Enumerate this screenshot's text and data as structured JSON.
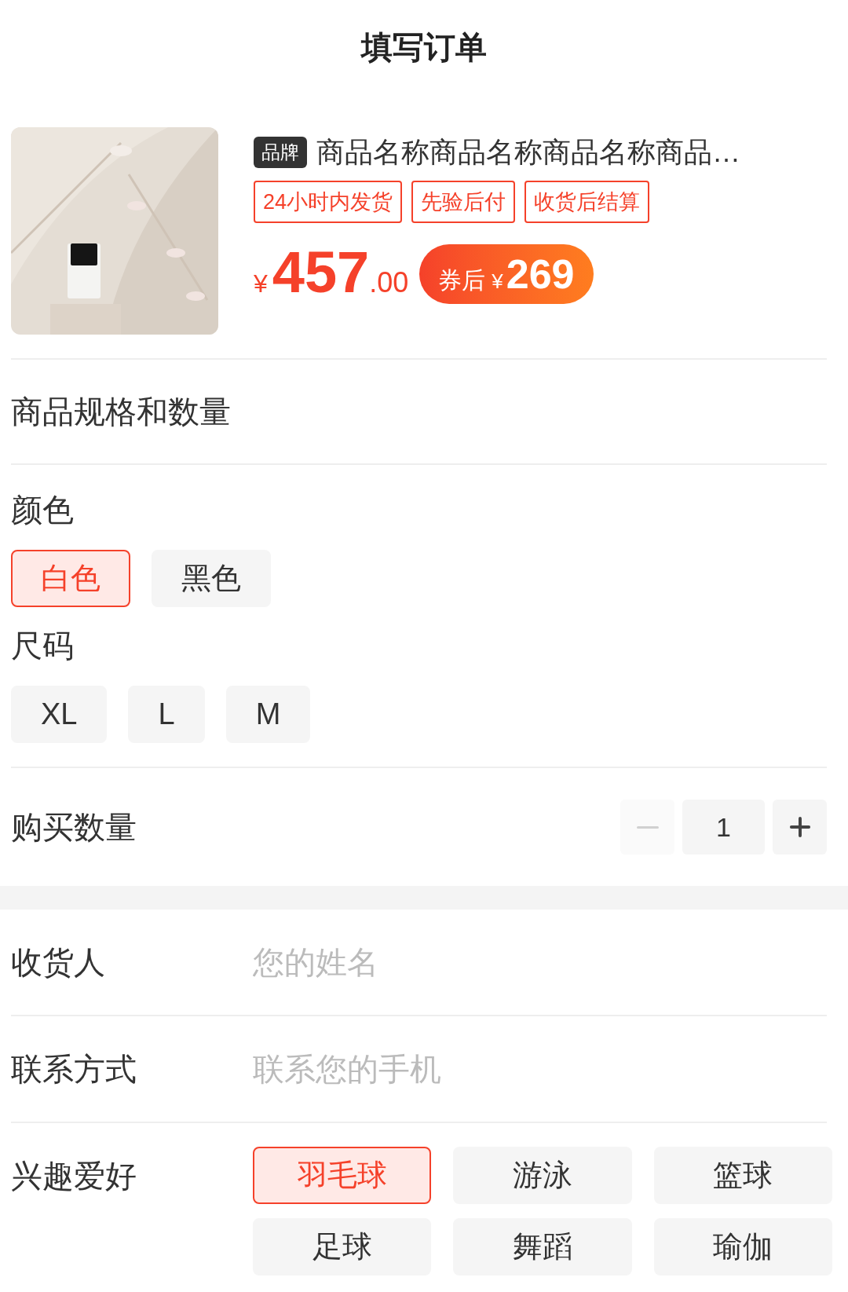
{
  "header": {
    "title": "填写订单"
  },
  "product": {
    "brand": "品牌",
    "name": "商品名称商品名称商品名称商品…",
    "tags": [
      "24小时内发货",
      "先验后付",
      "收货后结算"
    ],
    "price": {
      "currency": "¥",
      "integer": "457",
      "decimal": ".00"
    },
    "coupon": {
      "label": "券后",
      "currency": "¥",
      "amount": "269"
    }
  },
  "spec_section": {
    "title": "商品规格和数量"
  },
  "option_groups": [
    {
      "label": "颜色",
      "options": [
        {
          "label": "白色",
          "selected": true
        },
        {
          "label": "黑色",
          "selected": false
        }
      ]
    },
    {
      "label": "尺码",
      "options": [
        {
          "label": "XL",
          "selected": false
        },
        {
          "label": "L",
          "selected": false
        },
        {
          "label": "M",
          "selected": false
        }
      ]
    }
  ],
  "quantity": {
    "label": "购买数量",
    "value": "1",
    "decrement_disabled": true
  },
  "form": [
    {
      "label": "收货人",
      "placeholder": "您的姓名"
    },
    {
      "label": "联系方式",
      "placeholder": "联系您的手机"
    }
  ],
  "hobbies": {
    "label": "兴趣爱好",
    "options": [
      {
        "label": "羽毛球",
        "selected": true
      },
      {
        "label": "游泳",
        "selected": false
      },
      {
        "label": "篮球",
        "selected": false
      },
      {
        "label": "足球",
        "selected": false
      },
      {
        "label": "舞蹈",
        "selected": false
      },
      {
        "label": "瑜伽",
        "selected": false
      }
    ]
  }
}
